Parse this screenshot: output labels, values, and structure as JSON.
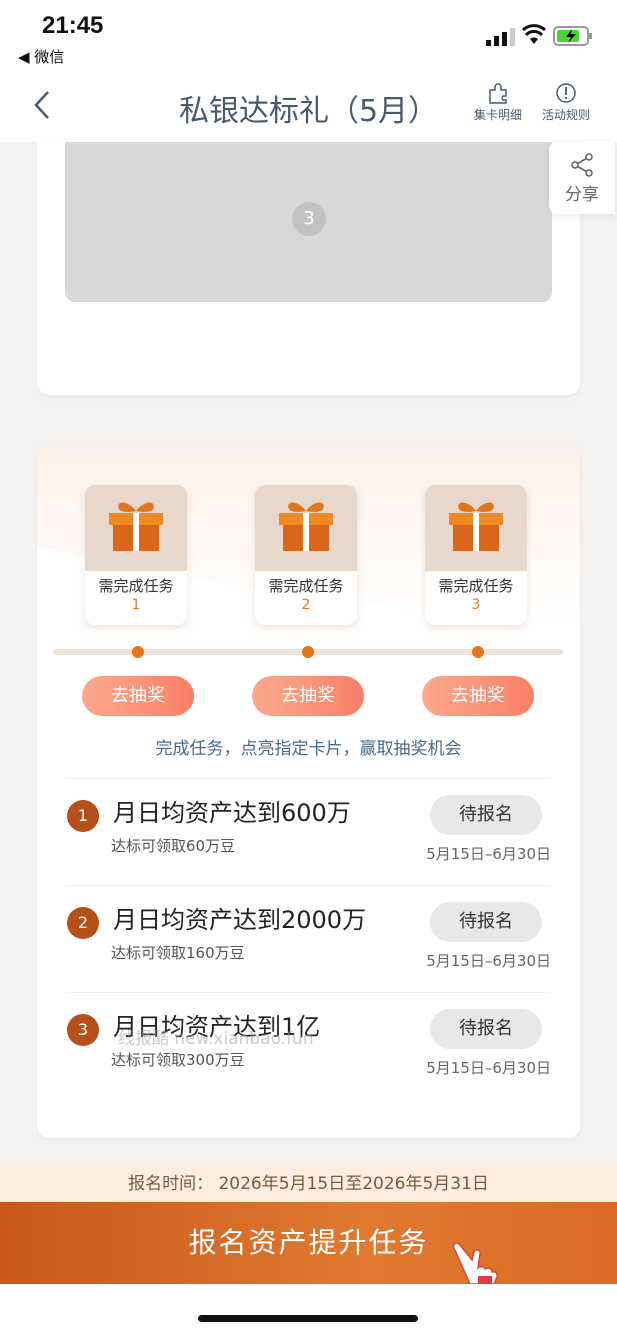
{
  "status": {
    "time": "21:45",
    "back_app": "◀ 微信"
  },
  "nav": {
    "title": "私银达标礼（5月）",
    "card_detail": "集卡明细",
    "rules": "活动规则"
  },
  "image_placeholder": {
    "index": "3"
  },
  "share": {
    "label": "分享"
  },
  "gifts": [
    {
      "label": "需完成任务",
      "count": "1"
    },
    {
      "label": "需完成任务",
      "count": "2"
    },
    {
      "label": "需完成任务",
      "count": "3"
    }
  ],
  "draw_button": "去抽奖",
  "hint": "完成任务，点亮指定卡片，赢取抽奖机会",
  "tasks": [
    {
      "num": "1",
      "title": "月日均资产达到600万",
      "sub": "达标可领取60万豆",
      "button": "待报名",
      "date": "5月15日–6月30日"
    },
    {
      "num": "2",
      "title": "月日均资产达到2000万",
      "sub": "达标可领取160万豆",
      "button": "待报名",
      "date": "5月15日–6月30日"
    },
    {
      "num": "3",
      "title": "月日均资产达到1亿",
      "sub": "达标可领取300万豆",
      "button": "待报名",
      "date": "5月15日–6月30日"
    }
  ],
  "watermark": "线报酷 new.xianbao.fun",
  "signup": {
    "label": "报名时间：",
    "range": "2026年5月15日至2026年5月31日"
  },
  "cta": {
    "label": "报名资产提升任务"
  },
  "colors": {
    "accent": "#e97418",
    "cta": "#d0642a",
    "title": "#4a5a6e"
  }
}
